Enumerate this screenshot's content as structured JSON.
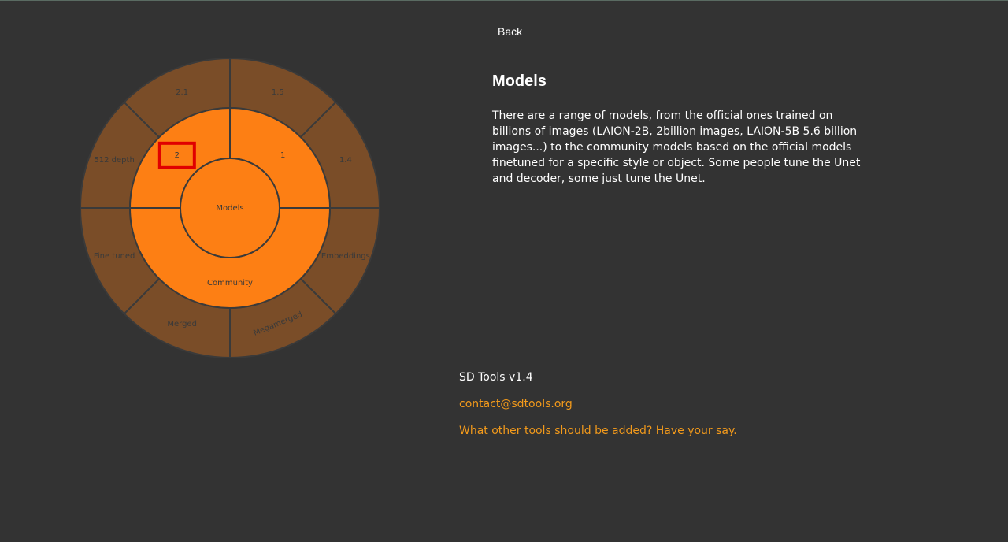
{
  "nav": {
    "back_label": "Back"
  },
  "sunburst": {
    "center": "Models",
    "inner": [
      {
        "label": "1",
        "start": 0,
        "end": 90
      },
      {
        "label": "Community",
        "start": 90,
        "end": 270
      },
      {
        "label": "2",
        "start": 270,
        "end": 360,
        "highlighted": true
      }
    ],
    "outer": [
      {
        "label": "1.5",
        "start": 0,
        "end": 45
      },
      {
        "label": "1.4",
        "start": 45,
        "end": 90
      },
      {
        "label": "Embeddings",
        "start": 90,
        "end": 135
      },
      {
        "label": "Megamerged",
        "start": 135,
        "end": 180,
        "rotate": -22
      },
      {
        "label": "Merged",
        "start": 180,
        "end": 225
      },
      {
        "label": "Fine tuned",
        "start": 225,
        "end": 270
      },
      {
        "label": "512 depth",
        "start": 270,
        "end": 315
      },
      {
        "label": "2.1",
        "start": 315,
        "end": 360
      }
    ],
    "colors": {
      "center": "#fd7f14",
      "inner": "#fd7f14",
      "outer": "#7a4d28",
      "stroke": "#3a3a3a",
      "highlight": "#e00000"
    }
  },
  "info": {
    "title": "Models",
    "description": "There are a range of models, from the official ones trained on billions of images (LAION-2B, 2billion images, LAION-5B 5.6 billion images...) to the community models based on the official models finetuned for a specific style or object. Some people tune the Unet and decoder, some just tune the Unet."
  },
  "footer": {
    "version": "SD Tools v1.4",
    "contact": "contact@sdtools.org",
    "feedback": "What other tools should be added? Have your say."
  }
}
